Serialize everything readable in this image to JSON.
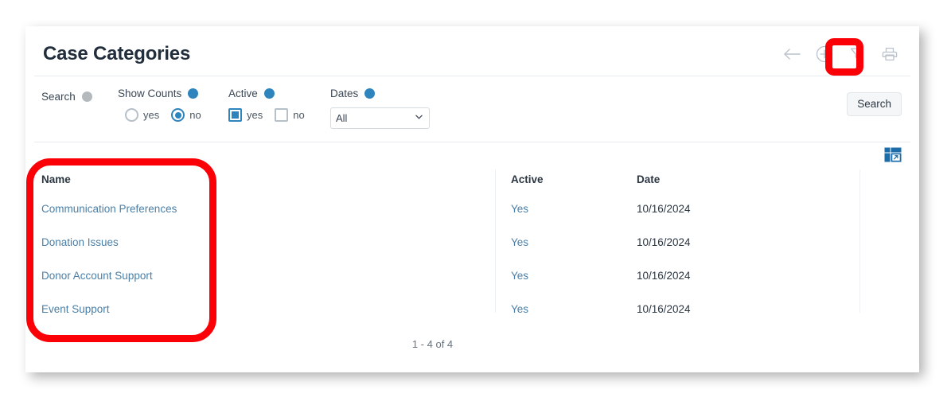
{
  "header": {
    "title": "Case Categories",
    "icons": [
      {
        "name": "back-arrow-icon",
        "label": "Back"
      },
      {
        "name": "add-circle-icon",
        "label": "Add New"
      },
      {
        "name": "filter-funnel-icon",
        "label": "Filter"
      },
      {
        "name": "printer-icon",
        "label": "Print"
      }
    ]
  },
  "filters": {
    "search": {
      "label": "Search",
      "dot_color": "#b4b9be"
    },
    "show_counts": {
      "label": "Show Counts",
      "dot_color": "#2e84bd",
      "type": "radio",
      "options": [
        {
          "label": "yes",
          "selected": false
        },
        {
          "label": "no",
          "selected": true
        }
      ]
    },
    "active": {
      "label": "Active",
      "dot_color": "#2e84bd",
      "type": "checkbox",
      "options": [
        {
          "label": "yes",
          "checked": true
        },
        {
          "label": "no",
          "checked": false
        }
      ]
    },
    "dates": {
      "label": "Dates",
      "dot_color": "#2e84bd",
      "selected": "All",
      "options": [
        "All"
      ]
    },
    "search_button": "Search"
  },
  "table": {
    "export_icon": "export-grid-icon",
    "columns": [
      "Name",
      "Active",
      "Date"
    ],
    "rows": [
      {
        "name": "Communication Preferences",
        "active": "Yes",
        "date": "10/16/2024"
      },
      {
        "name": "Donation Issues",
        "active": "Yes",
        "date": "10/16/2024"
      },
      {
        "name": "Donor Account Support",
        "active": "Yes",
        "date": "10/16/2024"
      },
      {
        "name": "Event Support",
        "active": "Yes",
        "date": "10/16/2024"
      }
    ],
    "pagination": "1 - 4 of 4"
  },
  "annotations": {
    "color": "#fb0007",
    "boxes": [
      {
        "name": "add-button-highlight",
        "target": "add-circle-icon"
      },
      {
        "name": "name-column-highlight",
        "target": "name-column"
      }
    ]
  },
  "theme": {
    "accent_blue": "#2e84bd",
    "link_blue": "#4a7fa8",
    "title_color": "#222e3c",
    "grey_dot": "#b4b9be",
    "annotation_red": "#fb0007"
  }
}
